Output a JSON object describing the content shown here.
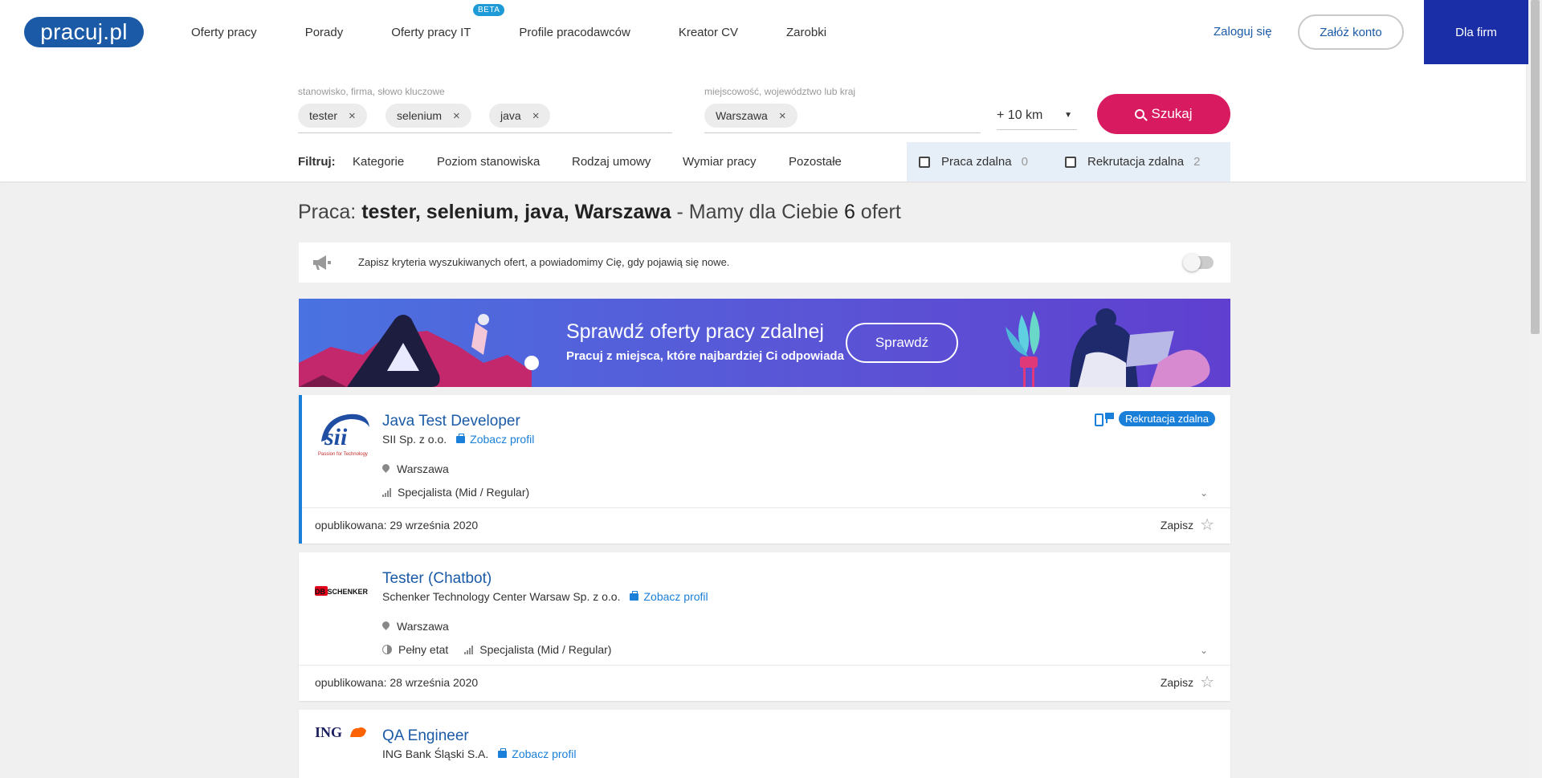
{
  "header": {
    "logo": "pracuj.pl",
    "nav": [
      {
        "label": "Oferty pracy"
      },
      {
        "label": "Porady"
      },
      {
        "label": "Oferty pracy IT",
        "badge": "BETA"
      },
      {
        "label": "Profile pracodawców"
      },
      {
        "label": "Kreator CV"
      },
      {
        "label": "Zarobki"
      }
    ],
    "login": "Zaloguj się",
    "register": "Załóż konto",
    "for_companies": "Dla firm"
  },
  "search": {
    "keyword_label": "stanowisko, firma, słowo kluczowe",
    "keywords": [
      "tester",
      "selenium",
      "java"
    ],
    "location_label": "miejscowość, województwo lub kraj",
    "locations": [
      "Warszawa"
    ],
    "radius": "+ 10 km",
    "button": "Szukaj",
    "remove_glyph": "×"
  },
  "filters": {
    "label": "Filtruj:",
    "items": [
      "Kategorie",
      "Poziom stanowiska",
      "Rodzaj umowy",
      "Wymiar pracy",
      "Pozostałe"
    ],
    "remote_work": {
      "label": "Praca zdalna",
      "count": "0"
    },
    "remote_recruitment": {
      "label": "Rekrutacja zdalna",
      "count": "2"
    }
  },
  "results": {
    "prefix": "Praca: ",
    "query": "tester, selenium, java, Warszawa",
    "middle": " - Mamy dla Ciebie ",
    "count": "6",
    "suffix": " ofert"
  },
  "alert": {
    "text": "Zapisz kryteria wyszukiwanych ofert, a powiadomimy Cię, gdy pojawią się nowe.",
    "enabled": false
  },
  "banner": {
    "title": "Sprawdź oferty pracy zdalnej",
    "subtitle": "Pracuj z miejsca, które najbardziej Ci odpowiada",
    "button": "Sprawdź"
  },
  "offers": [
    {
      "title": "Java Test Developer",
      "company": "SII Sp. z o.o.",
      "profile_link": "Zobacz profil",
      "logo_text": "sii",
      "logo_tagline": "Passion for Technology",
      "location": "Warszawa",
      "details": [
        "Specjalista (Mid / Regular)"
      ],
      "badge": "Rekrutacja zdalna",
      "published": "opublikowana: 29 września 2020",
      "save": "Zapisz"
    },
    {
      "title": "Tester (Chatbot)",
      "company": "Schenker Technology Center Warsaw Sp. z o.o.",
      "profile_link": "Zobacz profil",
      "logo_text": "DB SCHENKER",
      "location": "Warszawa",
      "details": [
        "Pełny etat",
        "Specjalista (Mid / Regular)"
      ],
      "published": "opublikowana: 28 września 2020",
      "save": "Zapisz"
    },
    {
      "title": "QA Engineer",
      "company": "ING Bank Śląski S.A.",
      "profile_link": "Zobacz profil",
      "logo_text": "ING"
    }
  ],
  "colors": {
    "brand_blue": "#1a5aa6",
    "link_blue": "#1a7fd8",
    "search_pink": "#d81b60",
    "firm_blue": "#1a2ea8"
  }
}
